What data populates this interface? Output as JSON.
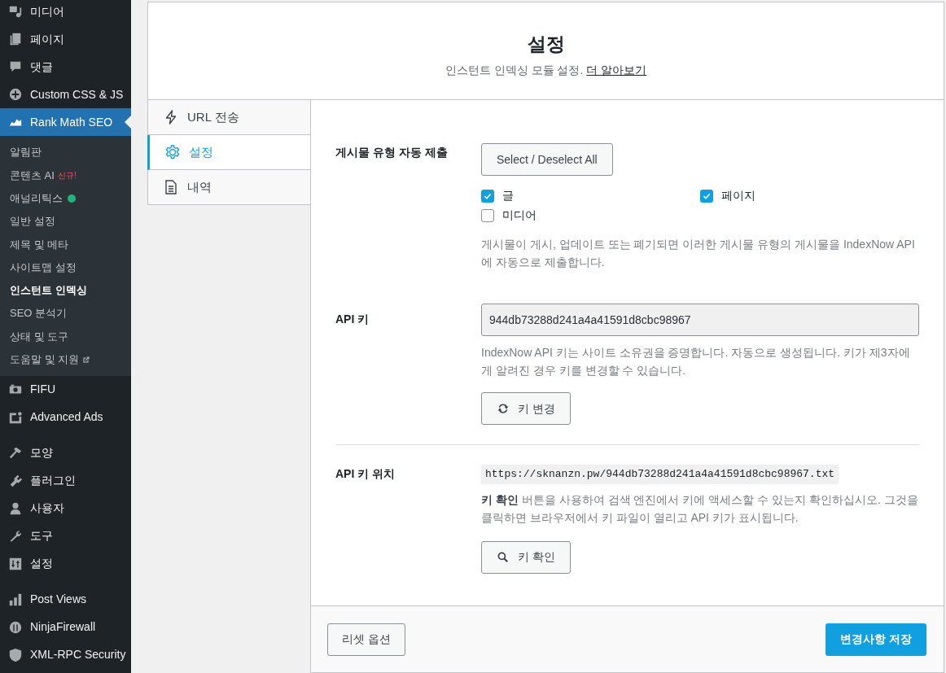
{
  "sidebar": {
    "groups": [
      [
        {
          "label": "미디어",
          "selected": false
        },
        {
          "label": "페이지",
          "selected": false
        },
        {
          "label": "댓글",
          "selected": false
        },
        {
          "label": "Custom CSS & JS",
          "selected": false
        },
        {
          "label": "Rank Math SEO",
          "selected": true,
          "children": [
            {
              "label": "알림판",
              "selected": false
            },
            {
              "label": "콘텐츠 AI",
              "badge": "신규!",
              "selected": false
            },
            {
              "label": "애널리틱스",
              "color": "#1fb57a",
              "selected": false
            },
            {
              "label": "일반 설정",
              "selected": false
            },
            {
              "label": "제목 및 메타",
              "selected": false
            },
            {
              "label": "사이트맵 설정",
              "selected": false
            },
            {
              "label": "인스턴트 인덱싱",
              "selected": true
            },
            {
              "label": "SEO 분석기",
              "selected": false
            },
            {
              "label": "상태 및 도구",
              "selected": false
            },
            {
              "label": "도움말 및 지원",
              "external": true,
              "selected": false
            }
          ]
        },
        {
          "label": "FIFU",
          "selected": false
        },
        {
          "label": "Advanced Ads",
          "selected": false
        }
      ],
      [
        {
          "label": "모양",
          "selected": false
        },
        {
          "label": "플러그인",
          "selected": false
        },
        {
          "label": "사용자",
          "selected": false
        },
        {
          "label": "도구",
          "selected": false
        },
        {
          "label": "설정",
          "selected": false
        }
      ],
      [
        {
          "label": "Post Views",
          "selected": false
        },
        {
          "label": "NinjaFirewall",
          "selected": false
        },
        {
          "label": "XML-RPC Security",
          "selected": false
        }
      ]
    ]
  },
  "header": {
    "title": "설정",
    "subtitle": "인스턴트 인덱싱 모듈 설정.",
    "link": "더 알아보기"
  },
  "tabs": [
    {
      "label": "URL 전송",
      "selected": false
    },
    {
      "label": "설정",
      "selected": true
    },
    {
      "label": "내역",
      "selected": false
    }
  ],
  "fields": [
    {
      "kind": "checkboxes",
      "label": "게시물 유형 자동 제출",
      "button": "Select / Deselect All",
      "options": [
        {
          "label": "글",
          "checked": true
        },
        {
          "label": "페이지",
          "checked": true
        },
        {
          "label": "미디어",
          "checked": false
        }
      ],
      "description": "게시물이 게시, 업데이트 또는 폐기되면 이러한 게시물 유형의 게시물을 IndexNow API에 자동으로 제출합니다."
    },
    {
      "kind": "key",
      "label": "API 키",
      "value": "944db73288d241a4a41591d8cbc98967",
      "description": "IndexNow API 키는 사이트 소유권을 증명합니다. 자동으로 생성됩니다. 키가 제3자에게 알려진 경우 키를 변경할 수 있습니다.",
      "button": "키 변경"
    },
    {
      "kind": "location",
      "label": "API 키 위치",
      "code": "https://sknanzn.pw/944db73288d241a4a41591d8cbc98967.txt",
      "description": "**키 확인** 버튼을 사용하여 검색 엔진에서 키에 액세스할 수 있는지 확인하십시오. 그것을 클릭하면 브라우저에서 키 파일이 열리고 API 키가 표시됩니다.",
      "button": "키 확인"
    }
  ],
  "footer": {
    "reset": "리셋 옵션",
    "save": "변경사항 저장"
  }
}
